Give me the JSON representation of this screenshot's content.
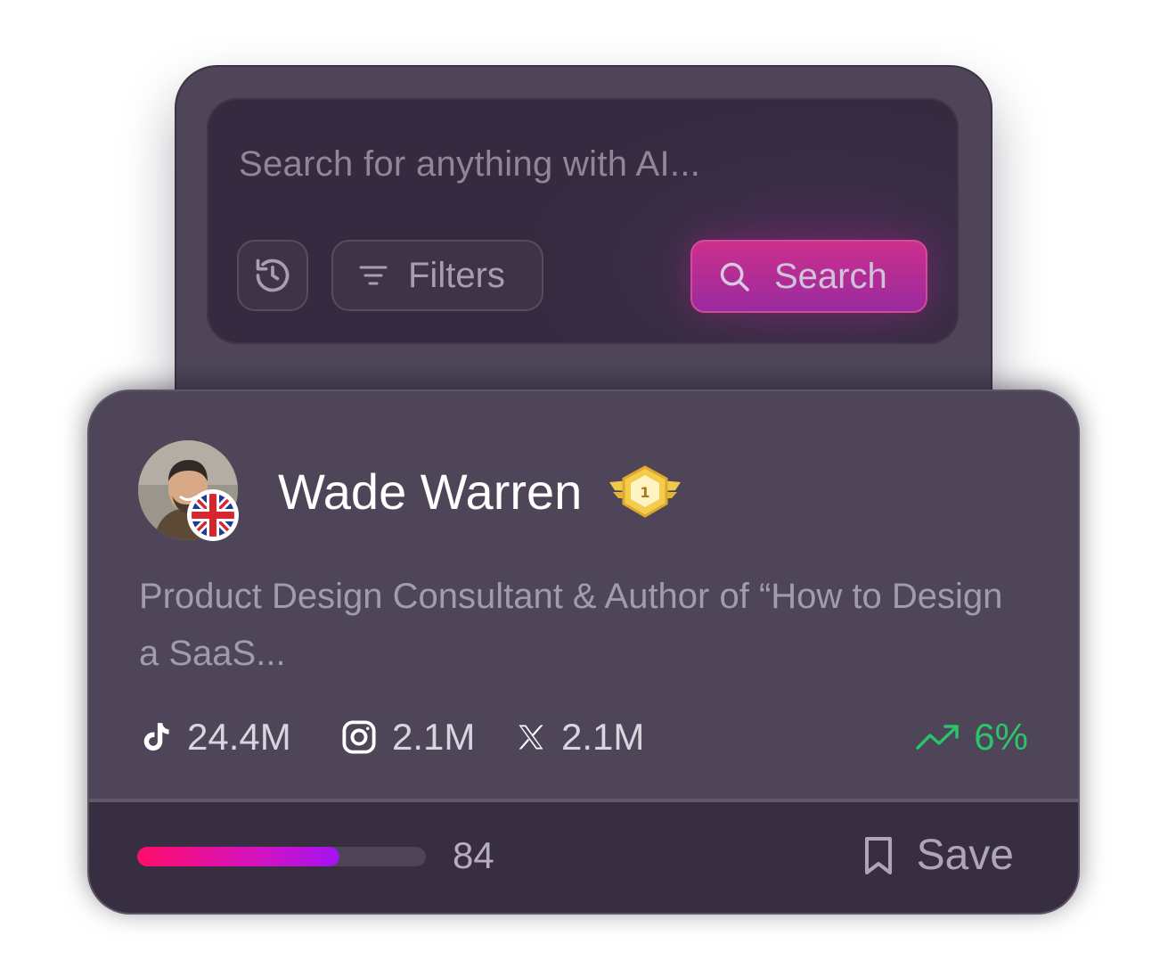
{
  "search": {
    "placeholder": "Search for anything with AI...",
    "filters_label": "Filters",
    "search_label": "Search"
  },
  "profile": {
    "name": "Wade Warren",
    "rank": "1",
    "country_flag": "uk-flag",
    "bio": "Product Design Consultant & Author of “How to Design a SaaS...",
    "stats": [
      {
        "platform": "tiktok-icon",
        "value": "24.4M"
      },
      {
        "platform": "instagram-icon",
        "value": "2.1M"
      },
      {
        "platform": "x-icon",
        "value": "2.1M"
      }
    ],
    "growth": "6%",
    "score": "84",
    "score_fraction": 0.7,
    "save_label": "Save"
  },
  "colors": {
    "panel": "#4e4558",
    "footer": "#372e42",
    "accent_start": "#ff0d69",
    "accent_end": "#a313f0",
    "growth_green": "#2bc46b"
  }
}
